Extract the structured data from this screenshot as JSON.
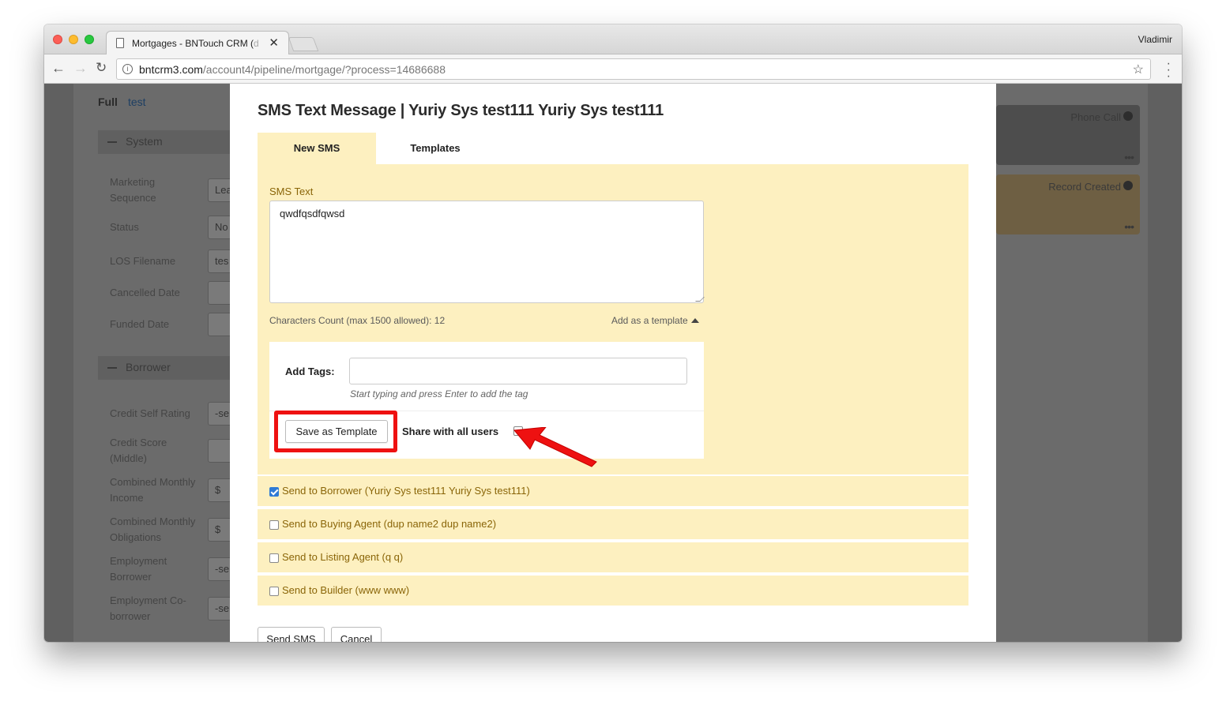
{
  "browser": {
    "tab_title": "Mortgages - BNTouch CRM (",
    "tab_title_faded": "d",
    "profile_name": "Vladimir",
    "url_domain": "bntcrm3.com",
    "url_path": "/account4/pipeline/mortgage/?process=14686688"
  },
  "background": {
    "full_label": "Full",
    "full_link": "test",
    "system_section": "System",
    "borrower_section": "Borrower",
    "system_fields": [
      {
        "label": "Marketing\nSequence",
        "value": "Lea"
      },
      {
        "label": "Status",
        "value": "No"
      },
      {
        "label": "LOS Filename",
        "value": "tes"
      },
      {
        "label": "Cancelled Date",
        "value": ""
      },
      {
        "label": "Funded Date",
        "value": ""
      }
    ],
    "borrower_fields": [
      {
        "label": "Credit Self Rating",
        "value": "-se"
      },
      {
        "label": "Credit Score\n(Middle)",
        "value": ""
      },
      {
        "label": "Combined Monthly\nIncome",
        "value": "$"
      },
      {
        "label": "Combined Monthly\nObligations",
        "value": "$"
      },
      {
        "label": "Employment\nBorrower",
        "value": "-se"
      },
      {
        "label": "Employment Co-\nborrower",
        "value": "-se"
      }
    ],
    "cards": [
      {
        "label": "Phone Call"
      },
      {
        "label": "Record Created"
      }
    ]
  },
  "modal": {
    "title": "SMS Text Message | Yuriy Sys test111 Yuriy Sys test111",
    "tabs": [
      "New SMS",
      "Templates"
    ],
    "sms_label": "SMS Text",
    "sms_value": "qwdfqsdfqwsd",
    "char_count": "Characters Count (max 1500 allowed): 12",
    "add_template_link": "Add as a template",
    "tags_label": "Add Tags:",
    "tags_hint": "Start typing and press Enter to add the tag",
    "save_template_button": "Save as Template",
    "share_label": "Share with all users",
    "share_checked": false,
    "recipients": [
      {
        "label": "Send to Borrower (Yuriy Sys test111 Yuriy Sys test111)",
        "checked": true
      },
      {
        "label": "Send to Buying Agent (dup name2 dup name2)",
        "checked": false
      },
      {
        "label": "Send to Listing Agent (q q)",
        "checked": false
      },
      {
        "label": "Send to Builder (www www)",
        "checked": false
      }
    ],
    "send_button": "Send SMS",
    "cancel_button": "Cancel"
  },
  "colors": {
    "panel_bg": "#fdf0c0",
    "label_brown": "#8a6508",
    "highlight_red": "#ee1111",
    "checkbox_blue": "#2f7bd6"
  }
}
